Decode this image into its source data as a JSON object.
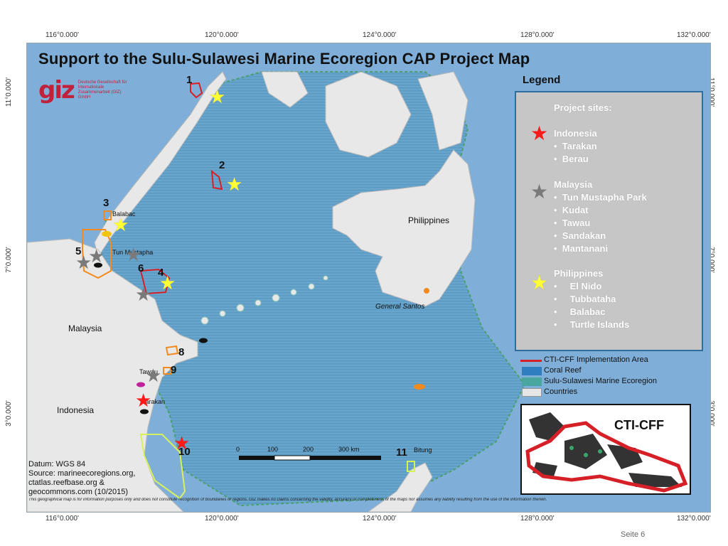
{
  "title": "Support to the Sulu-Sulawesi Marine Ecoregion CAP Project Map",
  "logo": {
    "mark": "giz",
    "org_text": "Deutsche Gesellschaft für Internationale Zusammenarbeit (GIZ) GmbH"
  },
  "coords": {
    "top": [
      "116°0.000'",
      "120°0.000'",
      "124°0.000'",
      "128°0.000'",
      "132°0.000'"
    ],
    "bottom": [
      "116°0.000'",
      "120°0.000'",
      "124°0.000'",
      "128°0.000'",
      "132°0.000'"
    ],
    "left": [
      "11°0.000'",
      "7°0.000'",
      "3°0.000'"
    ],
    "right": [
      "11°0.000'",
      "7°0.000'",
      "3°0.000'"
    ]
  },
  "legend": {
    "title": "Legend",
    "project_sites": "Project sites:",
    "groups": [
      {
        "country": "Indonesia",
        "star_color": "#ff1a1a",
        "sites": [
          "Tarakan",
          "Berau"
        ]
      },
      {
        "country": "Malaysia",
        "star_color": "#7a7a7a",
        "sites": [
          "Tun Mustapha Park",
          "Kudat",
          "Tawau",
          "Sandakan",
          "Mantanani"
        ]
      },
      {
        "country": "Philippines",
        "star_color": "#ffff33",
        "sites": [
          "El Nido",
          "Tubbataha",
          "Balabac",
          "Turtle Islands"
        ]
      }
    ],
    "keys": [
      {
        "label": "CTI-CFF Implementation Area",
        "color": "#d62027"
      },
      {
        "label": "Coral Reef",
        "color": "#2f7fc0"
      },
      {
        "label": "Sulu-Sulawesi Marine Ecoregion",
        "color": "#4aa7a0"
      },
      {
        "label": "Countries",
        "color": "#e6e6e6"
      }
    ]
  },
  "place_labels": {
    "philippines": "Philippines",
    "general_santos": "General Santos",
    "malaysia": "Malaysia",
    "indonesia": "Indonesia",
    "balabac": "Balabac",
    "tun_mustapha": "Tun Mustapha",
    "tawau": "Tawau",
    "tarakan": "Tarakan",
    "bitung": "Bitung"
  },
  "site_numbers": [
    "1",
    "2",
    "3",
    "4",
    "5",
    "6",
    "8",
    "9",
    "10",
    "11"
  ],
  "scale": {
    "ticks": [
      "0",
      "100",
      "200",
      "300 km"
    ]
  },
  "inset_title": "CTI-CFF",
  "datum": {
    "line1": "Datum: WGS 84",
    "line2": "Source: marineecoregions.org,",
    "line3": "ctatlas.reefbase.org &",
    "line4": "geocommons.com (10/2015)"
  },
  "disclaimer": "This geographical map is for information purposes only and does not constitute recognition of boundaries or regions. GIZ makes no claims concerning the validity, accuracy or completeness of the maps nor assumes any liability resulting from the use of the information therein.",
  "footer": "Seite 6",
  "colors": {
    "sea": "#7fafd8",
    "ecoregion": "#5b9bc0",
    "land": "#e8e8e8",
    "cti_border": "#d62027",
    "indonesia_star": "#ff1a1a",
    "malaysia_star": "#7a7a7a",
    "philippines_star": "#ffff33"
  }
}
